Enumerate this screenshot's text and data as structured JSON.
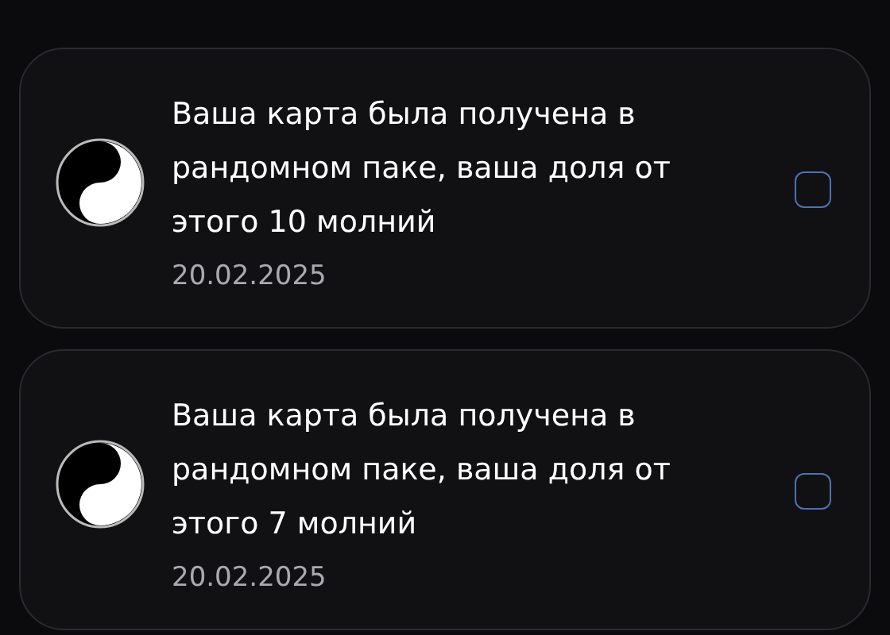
{
  "notifications": [
    {
      "message": "Ваша карта была получена в рандомном паке, ваша доля от этого 10 молний",
      "date": "20.02.2025",
      "checked": false
    },
    {
      "message": "Ваша карта была получена в рандомном паке, ваша доля от этого 7 молний",
      "date": "20.02.2025",
      "checked": false
    }
  ]
}
